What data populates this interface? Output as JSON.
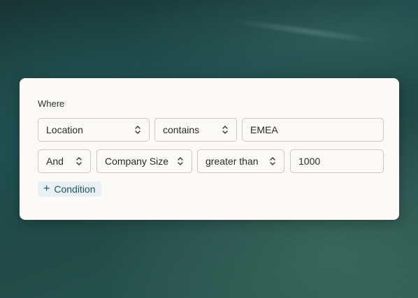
{
  "filter": {
    "where_label": "Where",
    "row1": {
      "field": "Location",
      "operator": "contains",
      "value": "EMEA"
    },
    "row2": {
      "conjunction": "And",
      "field": "Company Size",
      "operator": "greater than",
      "value": "1000"
    },
    "add_condition_label": "Condition",
    "add_condition_icon": "plus-icon"
  },
  "colors": {
    "card_background": "#fbfaf6",
    "field_border": "#c9c7c1",
    "add_button_background": "#e9f1f4",
    "add_button_text": "#1f5562"
  }
}
